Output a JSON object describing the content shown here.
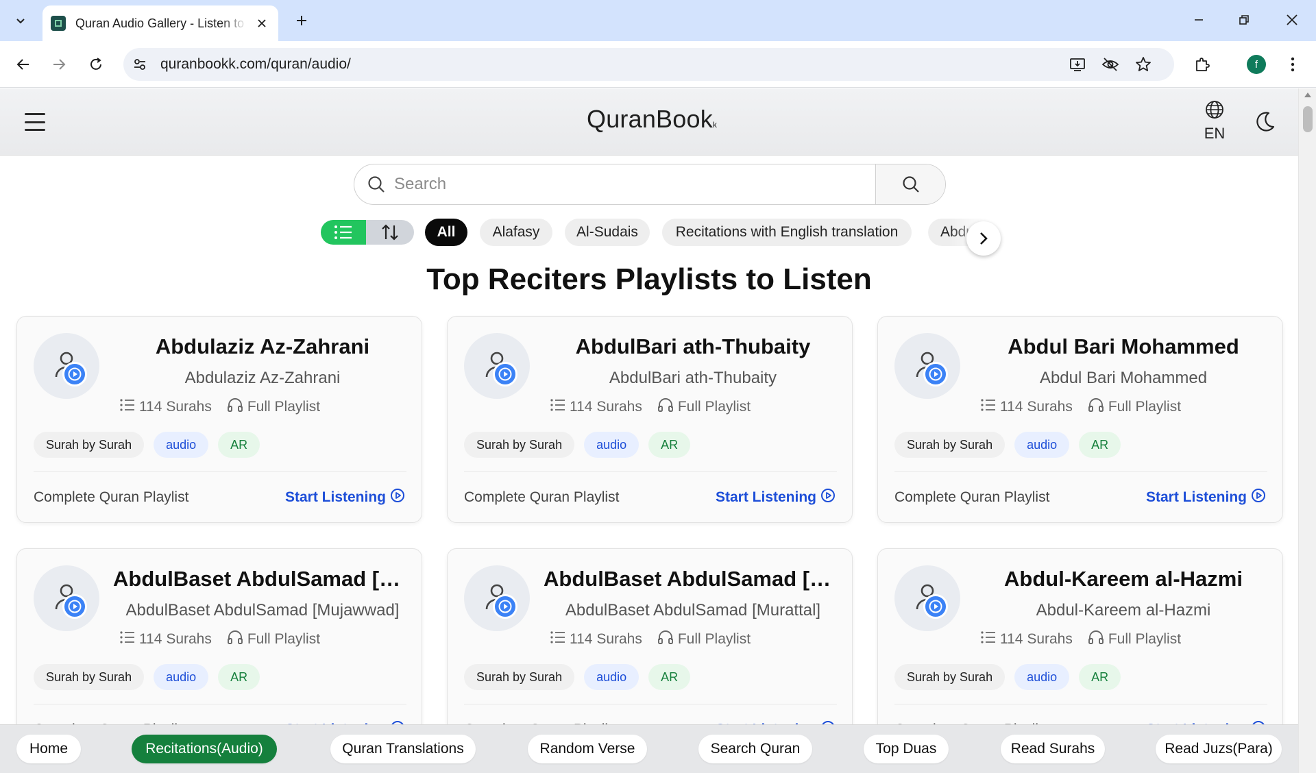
{
  "browser": {
    "tab_title": "Quran Audio Gallery - Listen to",
    "url": "quranbookk.com/quran/audio/",
    "profile_initial": "f"
  },
  "header": {
    "logo": "QuranBook",
    "logo_suffix": "k",
    "language": "EN"
  },
  "search": {
    "placeholder": "Search"
  },
  "filters": {
    "chips": [
      "All",
      "Alafasy",
      "Al-Sudais",
      "Recitations with English translation",
      "Abdul Ba"
    ],
    "active": "All"
  },
  "section_title": "Top Reciters Playlists to Listen",
  "cards": [
    {
      "title": "Abdulaziz Az-Zahrani",
      "subtitle": "Abdulaziz Az-Zahrani",
      "surahs": "114 Surahs",
      "playlist": "Full Playlist",
      "tags": [
        "Surah by Surah",
        "audio",
        "AR"
      ],
      "footer": "Complete Quran Playlist",
      "cta": "Start Listening"
    },
    {
      "title": "AbdulBari ath-Thubaity",
      "subtitle": "AbdulBari ath-Thubaity",
      "surahs": "114 Surahs",
      "playlist": "Full Playlist",
      "tags": [
        "Surah by Surah",
        "audio",
        "AR"
      ],
      "footer": "Complete Quran Playlist",
      "cta": "Start Listening"
    },
    {
      "title": "Abdul Bari Mohammed",
      "subtitle": "Abdul Bari Mohammed",
      "surahs": "114 Surahs",
      "playlist": "Full Playlist",
      "tags": [
        "Surah by Surah",
        "audio",
        "AR"
      ],
      "footer": "Complete Quran Playlist",
      "cta": "Start Listening"
    },
    {
      "title": "AbdulBaset AbdulSamad [Mujawwad]",
      "subtitle": "AbdulBaset AbdulSamad [Mujawwad]",
      "surahs": "114 Surahs",
      "playlist": "Full Playlist",
      "tags": [
        "Surah by Surah",
        "audio",
        "AR"
      ],
      "footer": "Complete Quran Playlist",
      "cta": "Start Listening"
    },
    {
      "title": "AbdulBaset AbdulSamad [Murattal]",
      "subtitle": "AbdulBaset AbdulSamad [Murattal]",
      "surahs": "114 Surahs",
      "playlist": "Full Playlist",
      "tags": [
        "Surah by Surah",
        "audio",
        "AR"
      ],
      "footer": "Complete Quran Playlist",
      "cta": "Start Listening"
    },
    {
      "title": "Abdul-Kareem al-Hazmi",
      "subtitle": "Abdul-Kareem al-Hazmi",
      "surahs": "114 Surahs",
      "playlist": "Full Playlist",
      "tags": [
        "Surah by Surah",
        "audio",
        "AR"
      ],
      "footer": "Complete Quran Playlist",
      "cta": "Start Listening"
    }
  ],
  "bottom_nav": {
    "items": [
      "Home",
      "Recitations(Audio)",
      "Quran Translations",
      "Random Verse",
      "Search Quran",
      "Top Duas",
      "Read Surahs",
      "Read Juzs(Para)"
    ],
    "active": "Recitations(Audio)"
  },
  "colors": {
    "accent_green": "#22c55e",
    "nav_active": "#15803d",
    "link_blue": "#1d4ed8",
    "play_blue": "#3b82f6"
  }
}
